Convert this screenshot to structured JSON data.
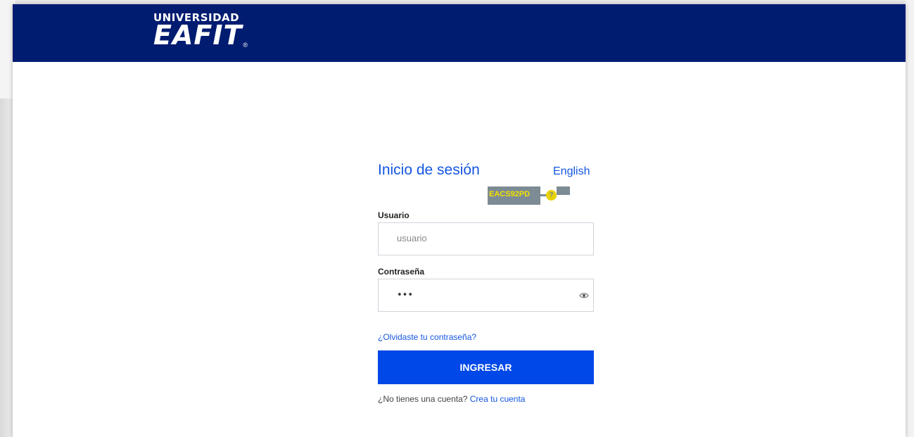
{
  "header": {
    "logo_top": "UNIVERSIDAD",
    "logo_main": "EAFIT",
    "logo_reg": "®",
    "bg_color": "#001c71"
  },
  "login": {
    "title": "Inicio de sesión",
    "language_link": "English",
    "env_tag": "EACS92PD",
    "env_badge": "?",
    "username_label": "Usuario",
    "username_placeholder": "usuario",
    "username_value": "",
    "password_label": "Contraseña",
    "password_value": "•••",
    "password_icon": "eye-icon",
    "forgot_link": "¿Olvidaste tu contraseña?",
    "submit_label": "INGRESAR",
    "signup_text": "¿No tienes una cuenta?",
    "signup_link": "Crea tu cuenta",
    "accent_color": "#0048e8"
  }
}
